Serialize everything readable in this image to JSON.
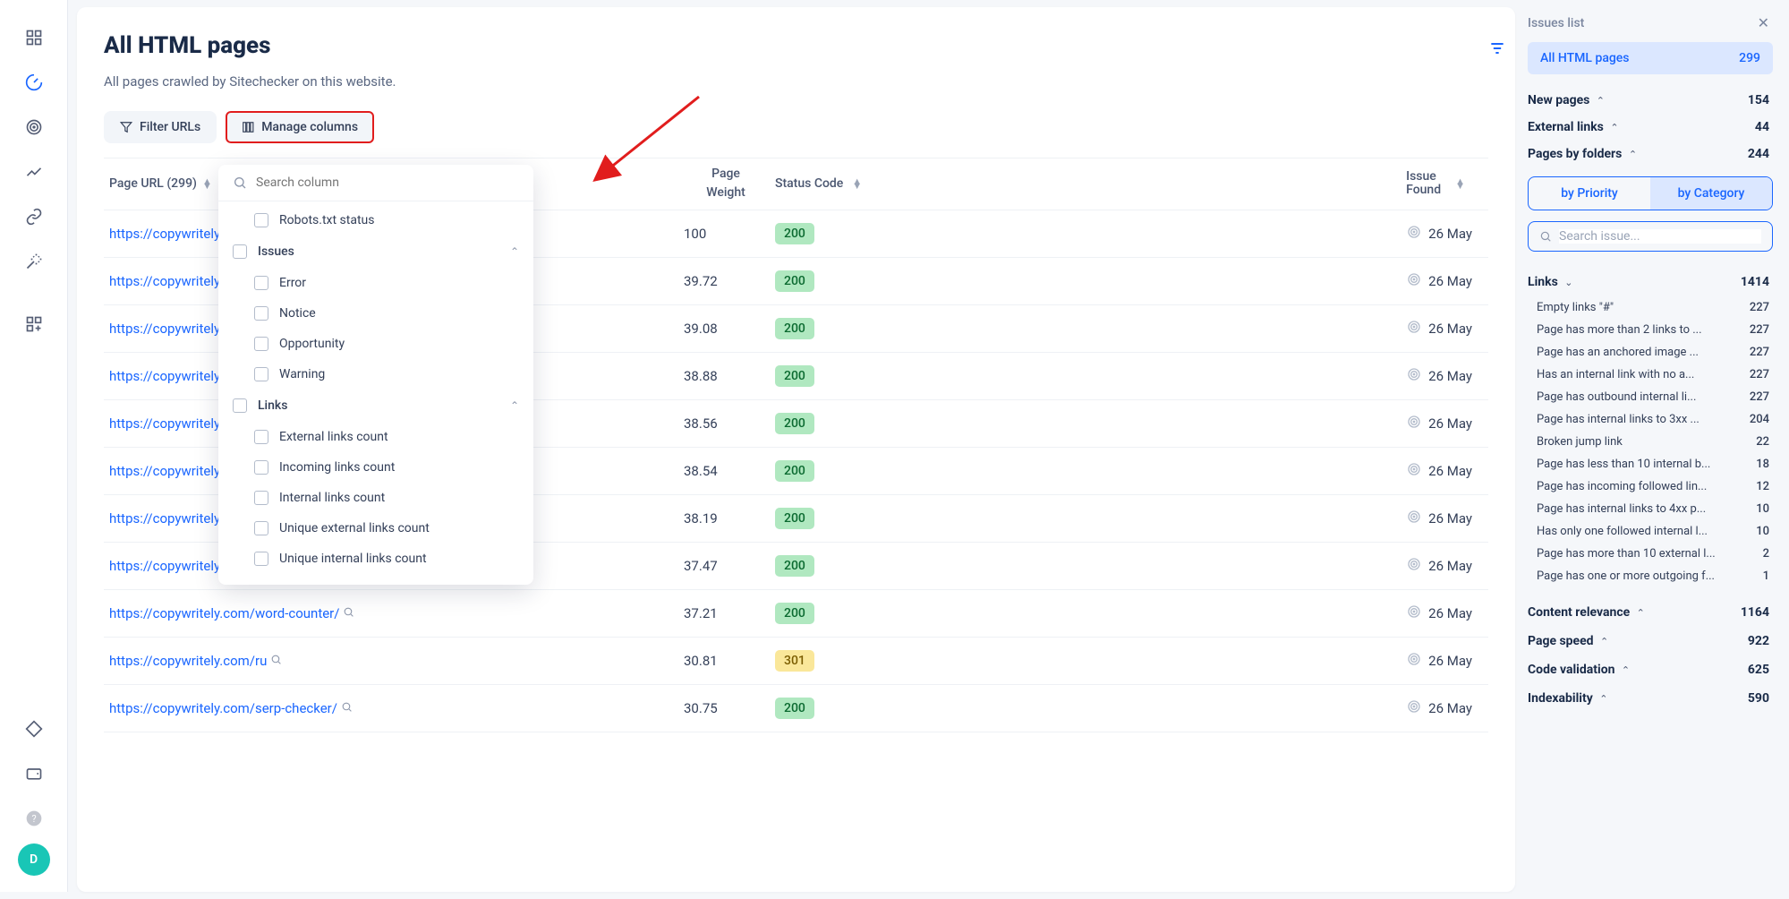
{
  "leftnav": {
    "items": [
      "grid",
      "gauge",
      "target",
      "trend",
      "link",
      "wand",
      "apps",
      "diamond",
      "wallet",
      "help"
    ],
    "avatar_letter": "D"
  },
  "header": {
    "title": "All HTML pages",
    "subtitle": "All pages crawled by Sitechecker on this website."
  },
  "toolbar": {
    "filter_label": "Filter URLs",
    "manage_label": "Manage columns"
  },
  "dropdown": {
    "search_placeholder": "Search column",
    "option_robots": "Robots.txt status",
    "group_issues": "Issues",
    "group_links": "Links",
    "issues_opts": [
      "Error",
      "Notice",
      "Opportunity",
      "Warning"
    ],
    "links_opts": [
      "External links count",
      "Incoming links count",
      "Internal links count",
      "Unique external links count",
      "Unique internal links count"
    ]
  },
  "table": {
    "headers": {
      "url": "Page URL (299)",
      "weight_1": "Page",
      "weight_2": "Weight",
      "status": "Status Code",
      "issue_1": "Issue",
      "issue_2": "Found"
    },
    "rows": [
      {
        "url": "https://copywritely.co",
        "truncated": true,
        "weight": "100",
        "status": "200",
        "date": "26 May"
      },
      {
        "url": "https://copywritely.co",
        "truncated": true,
        "weight": "39.72",
        "status": "200",
        "date": "26 May"
      },
      {
        "url": "https://copywritely.co",
        "truncated": true,
        "weight": "39.08",
        "status": "200",
        "date": "26 May"
      },
      {
        "url": "https://copywritely.co",
        "truncated": true,
        "weight": "38.88",
        "status": "200",
        "date": "26 May"
      },
      {
        "url": "https://copywritely.co",
        "truncated": true,
        "weight": "38.56",
        "status": "200",
        "date": "26 May"
      },
      {
        "url": "https://copywritely.co",
        "truncated": true,
        "weight": "38.54",
        "status": "200",
        "date": "26 May"
      },
      {
        "url": "https://copywritely.com/ru/",
        "truncated": false,
        "weight": "38.19",
        "status": "200",
        "date": "26 May"
      },
      {
        "url": "https://copywritely.com/readability-checker/",
        "truncated": false,
        "weight": "37.47",
        "status": "200",
        "date": "26 May"
      },
      {
        "url": "https://copywritely.com/word-counter/",
        "truncated": false,
        "weight": "37.21",
        "status": "200",
        "date": "26 May"
      },
      {
        "url": "https://copywritely.com/ru",
        "truncated": false,
        "weight": "30.81",
        "status": "301",
        "date": "26 May"
      },
      {
        "url": "https://copywritely.com/serp-checker/",
        "truncated": false,
        "weight": "30.75",
        "status": "200",
        "date": "26 May"
      }
    ]
  },
  "rightpane": {
    "title": "Issues list",
    "pill": {
      "label": "All HTML pages",
      "count": "299"
    },
    "top_sections": [
      {
        "label": "New pages",
        "count": "154"
      },
      {
        "label": "External links",
        "count": "44"
      },
      {
        "label": "Pages by folders",
        "count": "244"
      }
    ],
    "tabs": {
      "priority": "by Priority",
      "category": "by Category"
    },
    "search_placeholder": "Search issue...",
    "links_group": {
      "label": "Links",
      "count": "1414",
      "open": true
    },
    "links_items": [
      {
        "label": "Empty links \"#\"",
        "count": "227"
      },
      {
        "label": "Page has more than 2 links to ...",
        "count": "227"
      },
      {
        "label": "Page has an anchored image ...",
        "count": "227"
      },
      {
        "label": "Has an internal link with no a...",
        "count": "227"
      },
      {
        "label": "Page has outbound internal li...",
        "count": "227"
      },
      {
        "label": "Page has internal links to 3xx ...",
        "count": "204"
      },
      {
        "label": "Broken jump link",
        "count": "22"
      },
      {
        "label": "Page has less than 10 internal b...",
        "count": "18"
      },
      {
        "label": "Page has incoming followed lin...",
        "count": "12"
      },
      {
        "label": "Page has internal links to 4xx p...",
        "count": "10"
      },
      {
        "label": "Has only one followed internal l...",
        "count": "10"
      },
      {
        "label": "Page has more than 10 external l...",
        "count": "2"
      },
      {
        "label": "Page has one or more outgoing f...",
        "count": "1"
      }
    ],
    "bottom_groups": [
      {
        "label": "Content relevance",
        "count": "1164"
      },
      {
        "label": "Page speed",
        "count": "922"
      },
      {
        "label": "Code validation",
        "count": "625"
      },
      {
        "label": "Indexability",
        "count": "590"
      }
    ]
  }
}
